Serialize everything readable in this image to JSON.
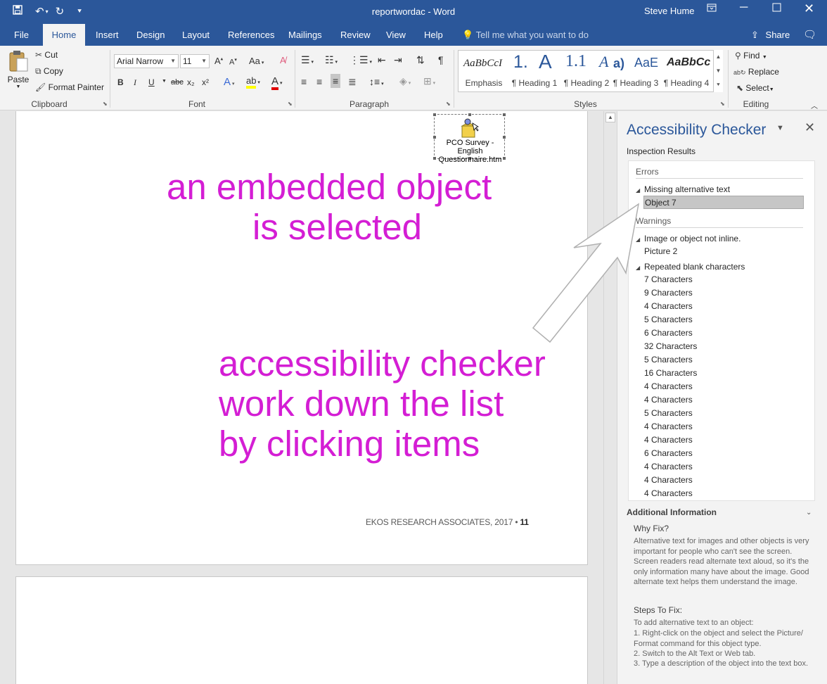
{
  "window": {
    "doc_title": "reportwordac  -  Word",
    "user": "Steve Hume"
  },
  "tabs": [
    "File",
    "Home",
    "Insert",
    "Design",
    "Layout",
    "References",
    "Mailings",
    "Review",
    "View",
    "Help"
  ],
  "active_tab": "Home",
  "tell_me_placeholder": "Tell me what you want to do",
  "share_label": "Share",
  "clipboard": {
    "paste": "Paste",
    "cut": "Cut",
    "copy": "Copy",
    "format_painter": "Format Painter",
    "label": "Clipboard"
  },
  "font": {
    "name": "Arial Narrow",
    "size": "11",
    "label": "Font",
    "bold": "B",
    "italic": "I",
    "underline": "U",
    "strike": "abc",
    "subscript": "x₂",
    "superscript": "x²"
  },
  "paragraph": {
    "label": "Paragraph"
  },
  "styles": {
    "label": "Styles",
    "items": [
      {
        "preview": "AaBbCcI",
        "name": "Emphasis"
      },
      {
        "preview": "1.",
        "name": "¶ Heading 1"
      },
      {
        "preview": "A",
        "name": "¶ Heading 2"
      },
      {
        "preview": "1.1",
        "name": "¶ Heading 3"
      },
      {
        "preview": "A",
        "name": "¶ Heading 4"
      },
      {
        "preview": "a)",
        "name": ""
      },
      {
        "preview": "AaE",
        "name": ""
      },
      {
        "preview": "AaBbCc",
        "name": ""
      }
    ]
  },
  "editing": {
    "label": "Editing",
    "find": "Find",
    "replace": "Replace",
    "select": "Select"
  },
  "document": {
    "object_label_line1": "PCO Survey - English",
    "object_label_line2": "Questionnaire.htm",
    "annotation1_line1": "an embedded object",
    "annotation1_line2": "is selected",
    "annotation2_line1": "accessibility checker",
    "annotation2_line2": "work down the list",
    "annotation2_line3": "by clicking items",
    "footer": "EKOS RESEARCH ASSOCIATES, 2017 •",
    "page_number": "11"
  },
  "pane": {
    "title": "Accessibility Checker",
    "inspection_results": "Inspection Results",
    "errors_heading": "Errors",
    "warnings_heading": "Warnings",
    "missing_alt": "Missing alternative text",
    "object7": "Object 7",
    "not_inline": "Image or object not inline.",
    "picture2": "Picture 2",
    "repeated_blank": "Repeated blank characters",
    "characters": [
      "7 Characters",
      "9 Characters",
      "4 Characters",
      "5 Characters",
      "6 Characters",
      "32 Characters",
      "5 Characters",
      "16 Characters",
      "4 Characters",
      "4 Characters",
      "5 Characters",
      "4 Characters",
      "4 Characters",
      "6 Characters",
      "4 Characters",
      "4 Characters",
      "4 Characters"
    ],
    "additional_info": "Additional Information",
    "why_fix": "Why Fix?",
    "why_fix_text": "Alternative text for images and other objects is very important for people who can't see the screen. Screen readers read alternate text aloud, so it's the only information many have about the image. Good alternate text helps them understand the image.",
    "steps_to_fix": "Steps To Fix:",
    "steps_intro": "To add alternative text to an object:",
    "step1": "1. Right-click on the object and select the Picture/ Format command for this object type.",
    "step2": "2. Switch to the Alt Text or Web tab.",
    "step3": "3. Type a description of the object into the text box."
  },
  "colors": {
    "word_blue": "#2b579a",
    "annotation_magenta": "#d41ed4"
  }
}
